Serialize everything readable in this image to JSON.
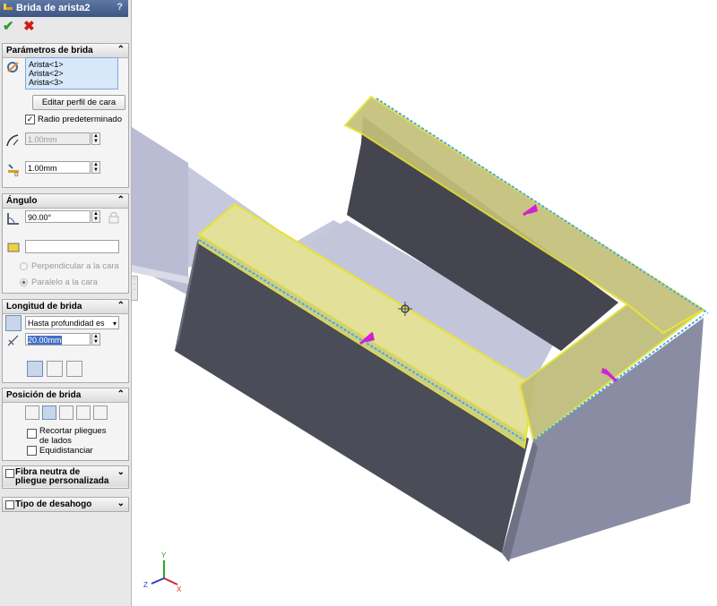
{
  "panel": {
    "title": "Brida de arista2",
    "help": "?",
    "ok_icon": "check-icon",
    "cancel_icon": "x-icon",
    "params": {
      "header": "Parámetros de brida",
      "edges": [
        "Arista<1>",
        "Arista<2>",
        "Arista<3>"
      ],
      "edit_profile": "Editar perfil de cara",
      "default_radius": "Radio predeterminado",
      "radius": "1.00mm",
      "gap": "1.00mm"
    },
    "angle": {
      "header": "Ángulo",
      "value": "90.00°",
      "face": "",
      "perp": "Perpendicular a la cara",
      "parallel": "Paralelo a la cara"
    },
    "length": {
      "header": "Longitud de brida",
      "condition": "Hasta profundidad es",
      "value": "20.00mm"
    },
    "position": {
      "header": "Posición de brida",
      "trim": "Recortar pliegues de lados",
      "offset": "Equidistanciar"
    },
    "neutral": {
      "header": "Fibra neutra de pliegue personalizada"
    },
    "relief": {
      "header": "Tipo de desahogo"
    }
  },
  "triad": {
    "x": "X",
    "y": "Y",
    "z": "Z"
  },
  "colors": {
    "accent": "#3d5683",
    "selection": "#e8e53a",
    "handle": "#d21fd6",
    "body": "#4b4d58"
  }
}
